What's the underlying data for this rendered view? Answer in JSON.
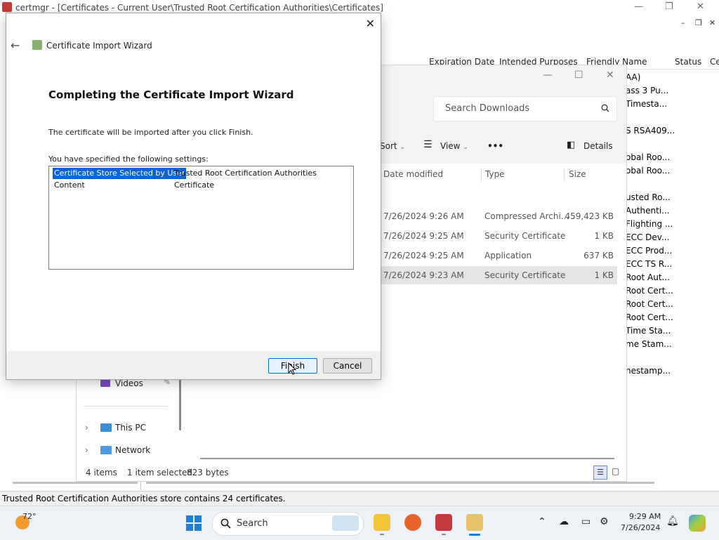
{
  "certmgr": {
    "title": "certmgr - [Certificates - Current User\\Trusted Root Certification Authorities\\Certificates]",
    "columns": [
      "Expiration Date",
      "Intended Purposes",
      "Friendly Name",
      "Status",
      "Ce"
    ],
    "friendly_names": [
      "AA)",
      "ass 3 Pu...",
      "Timesta...",
      "S RSA409...",
      "obal Roo...",
      "obal Roo...",
      "usted Ro...",
      "Authenti...",
      "Flighting ...",
      "ECC Dev...",
      "ECC Prod...",
      "ECC TS R...",
      "Root Aut...",
      "Root Cert...",
      "Root Cert...",
      "Root Cert...",
      "Time Sta...",
      "me Stam...",
      "nestamp..."
    ],
    "status_bar": "Trusted Root Certification Authorities store contains 24 certificates."
  },
  "explorer": {
    "search_placeholder": "Search Downloads",
    "toolbar": {
      "sort": "Sort",
      "view": "View",
      "more": "•••",
      "details": "Details"
    },
    "columns": {
      "date": "Date modified",
      "type": "Type",
      "size": "Size"
    },
    "files": [
      {
        "date": "7/26/2024 9:26 AM",
        "type": "Compressed Archi...",
        "size": "459,423 KB"
      },
      {
        "date": "7/26/2024 9:25 AM",
        "type": "Security Certificate",
        "size": "1 KB"
      },
      {
        "date": "7/26/2024 9:25 AM",
        "type": "Application",
        "size": "637 KB"
      },
      {
        "date": "7/26/2024 9:23 AM",
        "type": "Security Certificate",
        "size": "1 KB"
      }
    ],
    "nav": {
      "videos": "Videos",
      "this_pc": "This PC",
      "network": "Network"
    },
    "status": {
      "items": "4 items",
      "selected": "1 item selected",
      "bytes": "823 bytes"
    }
  },
  "wizard": {
    "title": "Certificate Import Wizard",
    "heading": "Completing the Certificate Import Wizard",
    "info": "The certificate will be imported after you click Finish.",
    "settings_label": "You have specified the following settings:",
    "settings": [
      {
        "key": "Certificate Store Selected by User",
        "value": "Trusted Root Certification Authorities"
      },
      {
        "key": "Content",
        "value": "Certificate"
      }
    ],
    "finish": "Finish",
    "cancel": "Cancel"
  },
  "taskbar": {
    "weather": "72°",
    "search": "Search",
    "time": "9:29 AM",
    "date": "7/26/2024"
  }
}
